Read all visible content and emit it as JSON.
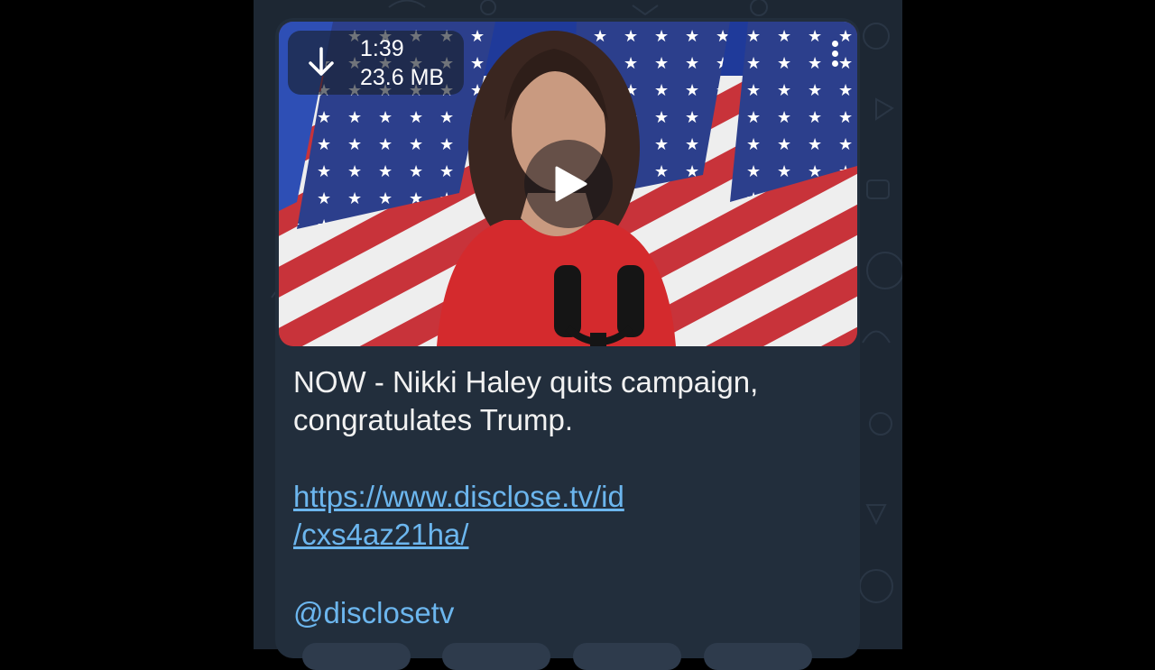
{
  "video": {
    "duration": "1:39",
    "file_size": "23.6 MB",
    "download_icon": "arrow-down-icon",
    "menu_icon": "more-vertical-icon",
    "play_icon": "play-icon"
  },
  "message": {
    "line1": "NOW - Nikki Haley quits campaign,",
    "line2": "congratulates Trump.",
    "link_line1": "https://www.disclose.tv/id",
    "link_line2": "/cxs4az21ha/",
    "mention": "@disclosetv"
  },
  "colors": {
    "chat_background": "#1d2733",
    "bubble": "#222e3c",
    "link": "#6cb6ee",
    "text": "#f2f2f2"
  }
}
